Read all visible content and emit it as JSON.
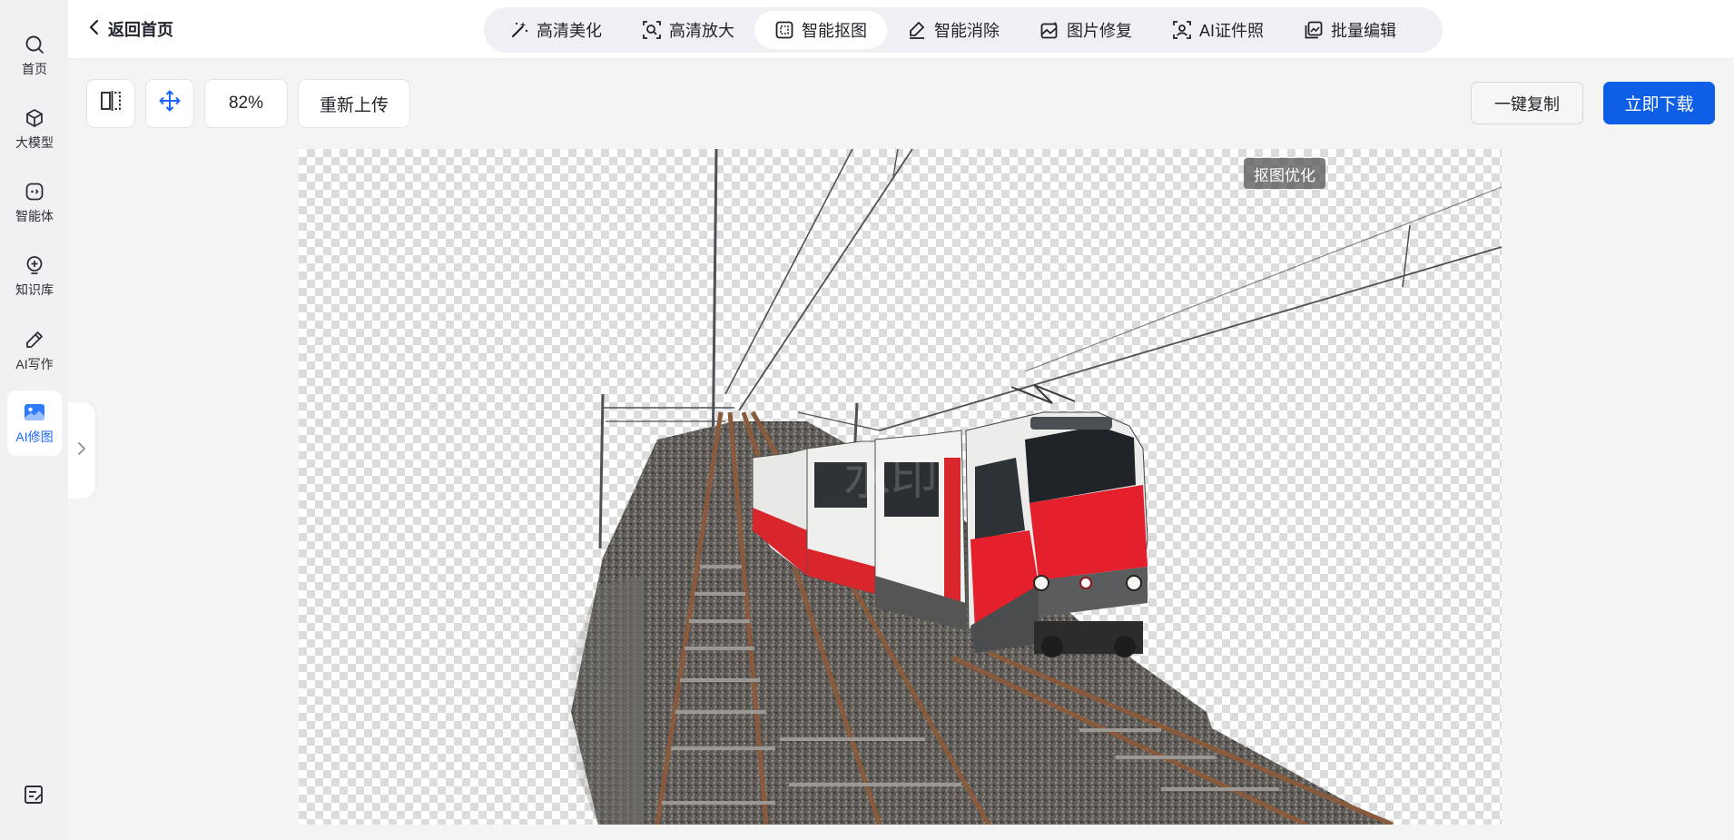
{
  "nav": {
    "items": [
      {
        "label": "首页",
        "icon": "search-icon"
      },
      {
        "label": "大模型",
        "icon": "cube-icon"
      },
      {
        "label": "智能体",
        "icon": "agent-icon"
      },
      {
        "label": "知识库",
        "icon": "bulb-icon"
      },
      {
        "label": "AI写作",
        "icon": "pen-icon"
      },
      {
        "label": "AI修图",
        "icon": "image-icon",
        "active": true
      }
    ],
    "bottom_icon": "notes-icon"
  },
  "header": {
    "back_label": "返回首页",
    "tools": [
      {
        "label": "高清美化",
        "icon": "magic-wand-icon"
      },
      {
        "label": "高清放大",
        "icon": "zoom-frame-icon"
      },
      {
        "label": "智能抠图",
        "icon": "cutout-icon",
        "active": true
      },
      {
        "label": "智能消除",
        "icon": "eraser-icon"
      },
      {
        "label": "图片修复",
        "icon": "photo-repair-icon"
      },
      {
        "label": "AI证件照",
        "icon": "id-photo-icon"
      },
      {
        "label": "批量编辑",
        "icon": "batch-edit-icon"
      }
    ]
  },
  "toolbar": {
    "compare_icon": "compare-icon",
    "move_icon": "move-icon",
    "zoom": "82%",
    "reupload_label": "重新上传",
    "copy_label": "一键复制",
    "download_label": "立即下载"
  },
  "canvas": {
    "badge_label": "抠图优化"
  },
  "colors": {
    "accent": "#1a66ff",
    "download_bg": "#0e5ee6",
    "train_red": "#e3202b"
  }
}
